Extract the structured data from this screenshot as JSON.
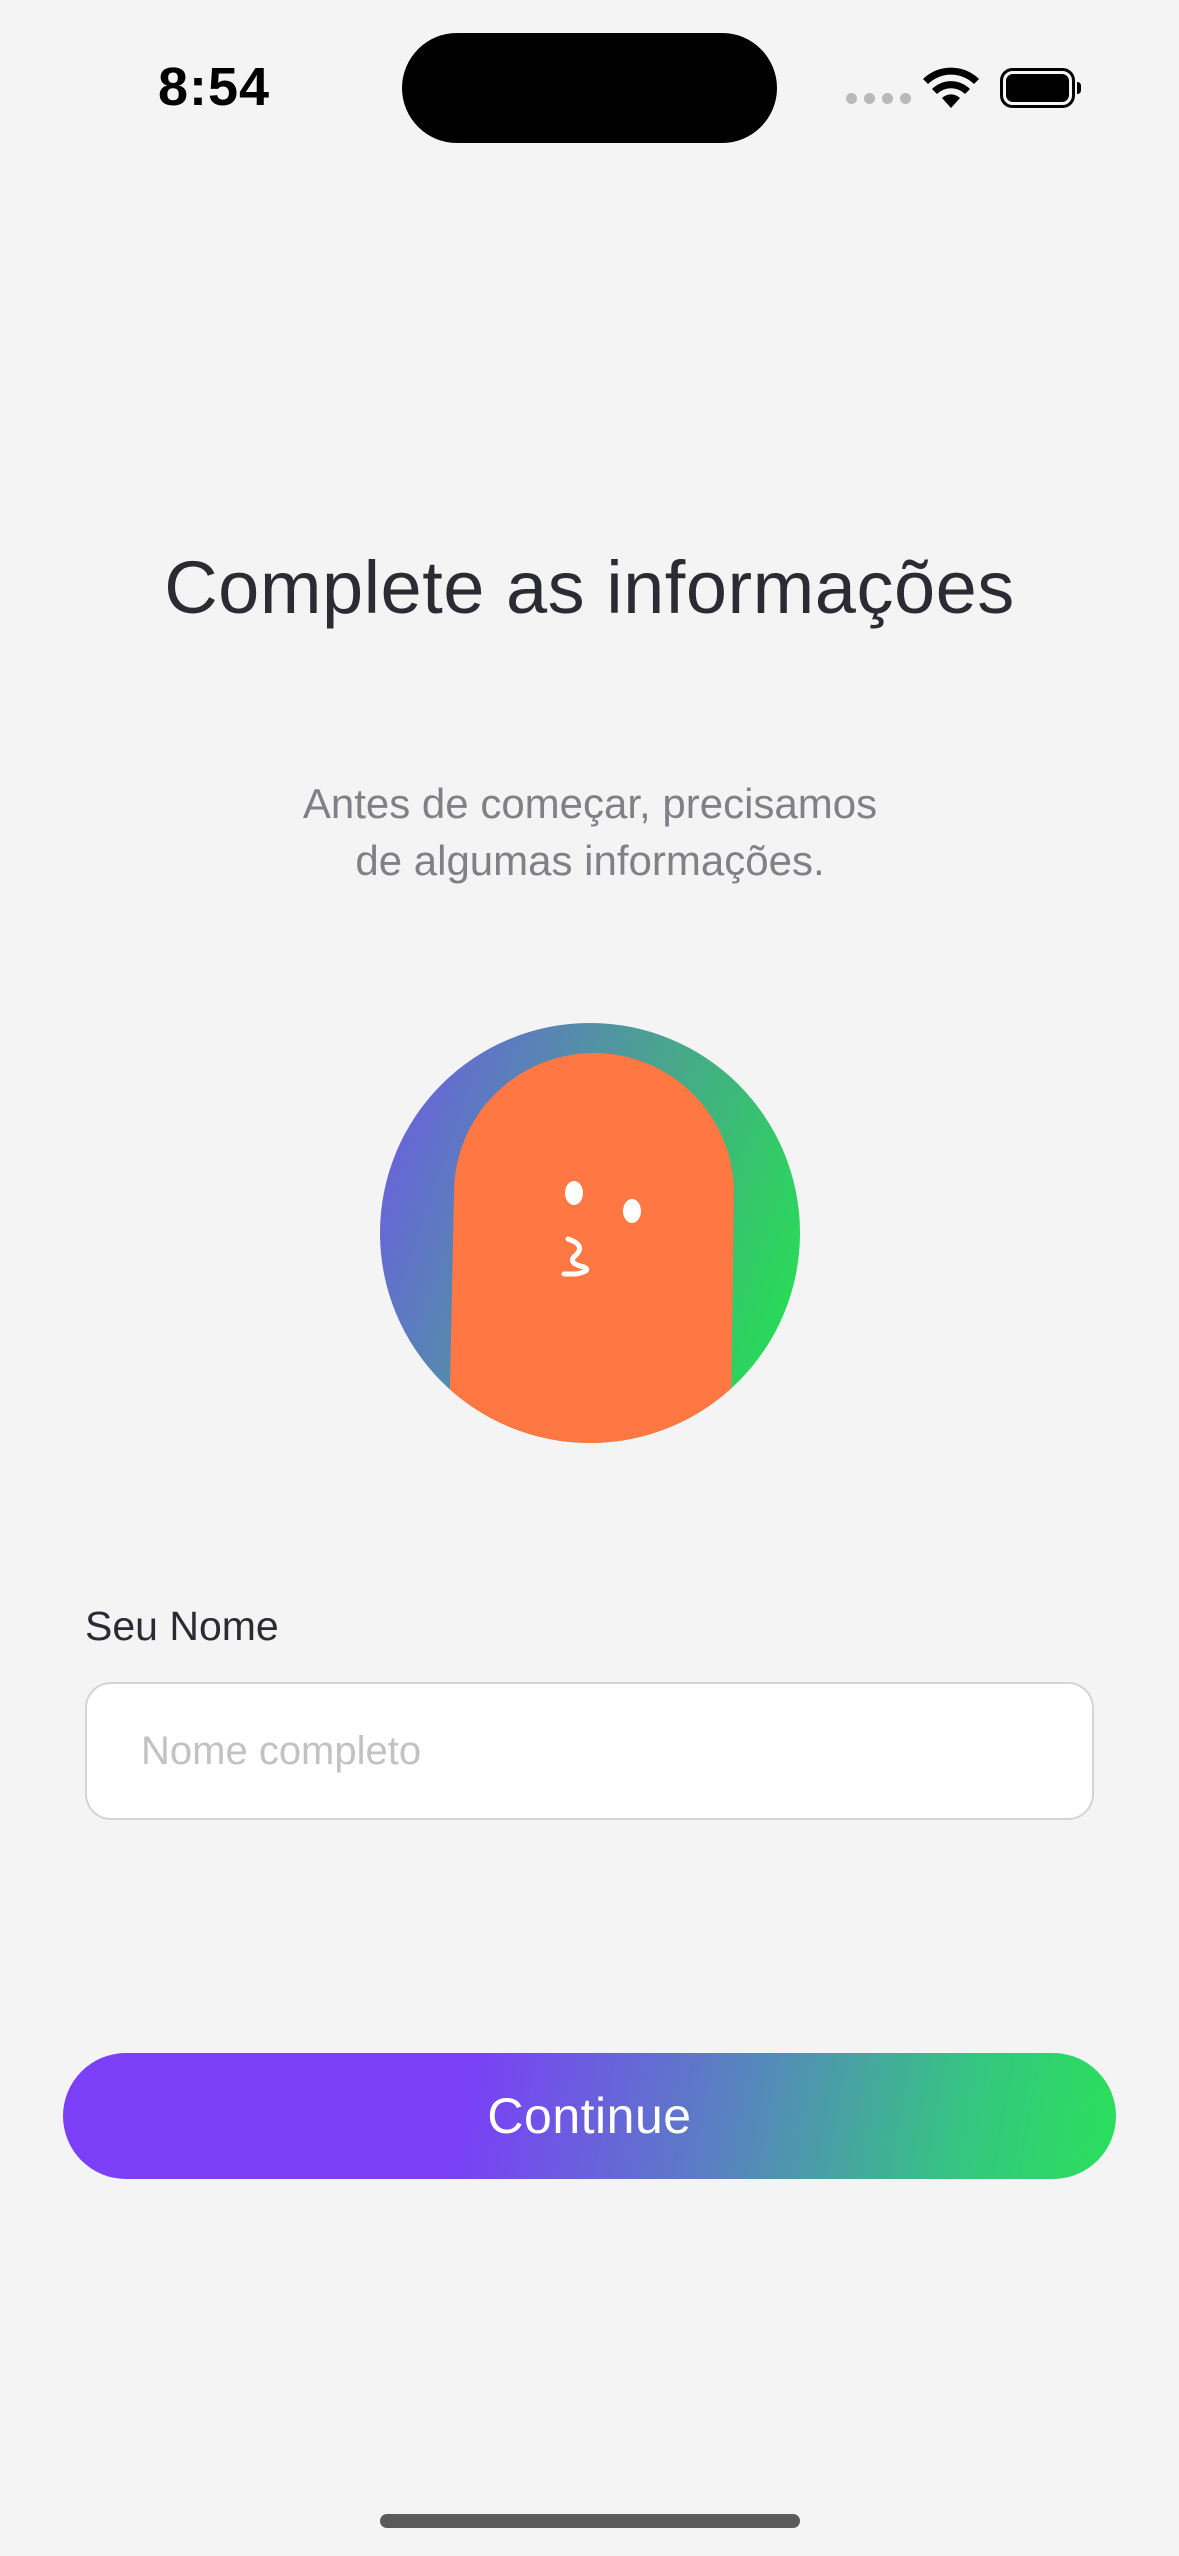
{
  "status_bar": {
    "time": "8:54",
    "icons": [
      "cellular-signal-icon",
      "wifi-icon",
      "battery-icon"
    ]
  },
  "header": {
    "title": "Complete as informações"
  },
  "intro": {
    "subtitle_lines": [
      "Antes de começar, precisamos",
      "de algumas informações."
    ]
  },
  "avatar": {
    "icon": "character-avatar-icon",
    "ring_gradient": [
      "#6a5fe0",
      "#4aa38f",
      "#2ad85a"
    ],
    "character_color": "#ff7742"
  },
  "form": {
    "name_label": "Seu Nome",
    "name_value": "",
    "name_placeholder": "Nome completo"
  },
  "actions": {
    "continue_label": "Continue"
  },
  "colors": {
    "background": "#f4f4f4",
    "text_primary": "#2b2b33",
    "text_secondary": "#808087",
    "button_gradient": [
      "#7a3ff7",
      "#5a7fc3",
      "#2ae05a"
    ]
  }
}
